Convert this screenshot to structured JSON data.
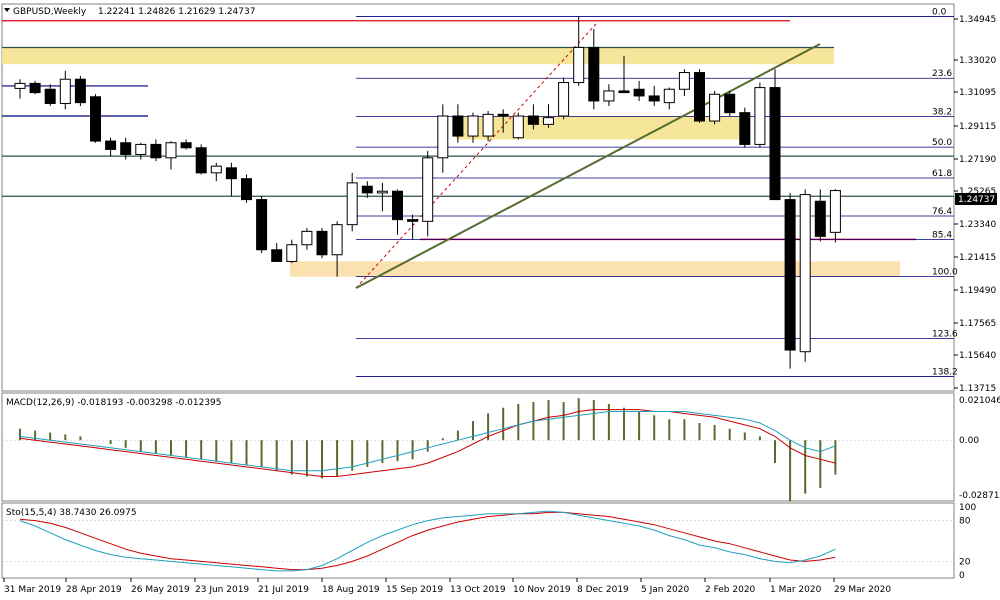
{
  "header": {
    "symbol": "GBPUSD,Weekly",
    "ohlc": "1.22241 1.24826 1.21629 1.24737"
  },
  "price_axis": {
    "ticks": [
      "1.34945",
      "1.33020",
      "1.31095",
      "1.29115",
      "1.27190",
      "1.25265",
      "1.23340",
      "1.21415",
      "1.19490",
      "1.17565",
      "1.15640",
      "1.13715"
    ],
    "current": "1.24737"
  },
  "date_axis": {
    "labels": [
      "31 Mar 2019",
      "28 Apr 2019",
      "26 May 2019",
      "23 Jun 2019",
      "21 Jul 2019",
      "18 Aug 2019",
      "15 Sep 2019",
      "13 Oct 2019",
      "10 Nov 2019",
      "8 Dec 2019",
      "5 Jan 2020",
      "2 Feb 2020",
      "1 Mar 2020",
      "29 Mar 2020"
    ]
  },
  "fibonacci": {
    "levels": [
      {
        "label": "0.0",
        "price": 1.3515
      },
      {
        "label": "23.6",
        "price": 1.3146
      },
      {
        "label": "38.2",
        "price": 1.2918
      },
      {
        "label": "50.0",
        "price": 1.2734
      },
      {
        "label": "61.8",
        "price": 1.2549
      },
      {
        "label": "76.4",
        "price": 1.2322
      },
      {
        "label": "85.4",
        "price": 1.2182
      },
      {
        "label": "100.0",
        "price": 1.1959
      },
      {
        "label": "123.6",
        "price": 1.159
      },
      {
        "label": "138.2",
        "price": 1.1362
      }
    ]
  },
  "macd": {
    "label": "MACD(12,26,9) -0.018193 -0.003298 -0.012395",
    "ticks": [
      "0.021046",
      "0.00",
      "-0.02871"
    ]
  },
  "stochastic": {
    "label": "Sto(15,5,4) 38.7430 26.0975",
    "ticks": [
      "100",
      "80",
      "20",
      "0"
    ]
  },
  "colors": {
    "bull": "#ffffff",
    "bear": "#000000",
    "fib": "#000080",
    "trend": "#556b2f",
    "red": "#e0001a",
    "zone": "#f5e69a",
    "zone2": "#fbe0b0",
    "hline": "#2f4f4f",
    "macd_hist": "#556b2f",
    "macd_signal": "#cc0000",
    "macd_line": "#20a0c0",
    "sto_main": "#20a0c0",
    "sto_signal": "#cc0000"
  },
  "chart_data": {
    "type": "candlestick",
    "symbol": "GBPUSD",
    "timeframe": "Weekly",
    "ylim": [
      1.1275,
      1.359
    ],
    "candles": [
      {
        "o": 1.3085,
        "h": 1.314,
        "l": 1.3025,
        "c": 1.3115
      },
      {
        "o": 1.3115,
        "h": 1.313,
        "l": 1.305,
        "c": 1.306
      },
      {
        "o": 1.308,
        "h": 1.311,
        "l": 1.298,
        "c": 1.2995
      },
      {
        "o": 1.2995,
        "h": 1.319,
        "l": 1.296,
        "c": 1.314
      },
      {
        "o": 1.314,
        "h": 1.316,
        "l": 1.298,
        "c": 1.3
      },
      {
        "o": 1.3035,
        "h": 1.305,
        "l": 1.276,
        "c": 1.277
      },
      {
        "o": 1.277,
        "h": 1.279,
        "l": 1.268,
        "c": 1.272
      },
      {
        "o": 1.276,
        "h": 1.279,
        "l": 1.266,
        "c": 1.269
      },
      {
        "o": 1.269,
        "h": 1.276,
        "l": 1.266,
        "c": 1.275
      },
      {
        "o": 1.275,
        "h": 1.278,
        "l": 1.265,
        "c": 1.267
      },
      {
        "o": 1.267,
        "h": 1.277,
        "l": 1.26,
        "c": 1.276
      },
      {
        "o": 1.276,
        "h": 1.278,
        "l": 1.272,
        "c": 1.273
      },
      {
        "o": 1.273,
        "h": 1.275,
        "l": 1.257,
        "c": 1.258
      },
      {
        "o": 1.258,
        "h": 1.264,
        "l": 1.253,
        "c": 1.262
      },
      {
        "o": 1.261,
        "h": 1.264,
        "l": 1.244,
        "c": 1.2545
      },
      {
        "o": 1.2545,
        "h": 1.257,
        "l": 1.24,
        "c": 1.242
      },
      {
        "o": 1.242,
        "h": 1.244,
        "l": 1.21,
        "c": 1.212
      },
      {
        "o": 1.212,
        "h": 1.216,
        "l": 1.205,
        "c": 1.205
      },
      {
        "o": 1.205,
        "h": 1.218,
        "l": 1.204,
        "c": 1.215
      },
      {
        "o": 1.215,
        "h": 1.225,
        "l": 1.212,
        "c": 1.223
      },
      {
        "o": 1.223,
        "h": 1.225,
        "l": 1.207,
        "c": 1.209
      },
      {
        "o": 1.209,
        "h": 1.229,
        "l": 1.1959,
        "c": 1.227
      },
      {
        "o": 1.227,
        "h": 1.258,
        "l": 1.223,
        "c": 1.252
      },
      {
        "o": 1.25,
        "h": 1.253,
        "l": 1.243,
        "c": 1.246
      },
      {
        "o": 1.246,
        "h": 1.252,
        "l": 1.235,
        "c": 1.247
      },
      {
        "o": 1.247,
        "h": 1.248,
        "l": 1.221,
        "c": 1.23
      },
      {
        "o": 1.23,
        "h": 1.233,
        "l": 1.218,
        "c": 1.229
      },
      {
        "o": 1.229,
        "h": 1.271,
        "l": 1.22,
        "c": 1.267
      },
      {
        "o": 1.267,
        "h": 1.299,
        "l": 1.258,
        "c": 1.292
      },
      {
        "o": 1.292,
        "h": 1.299,
        "l": 1.276,
        "c": 1.28
      },
      {
        "o": 1.28,
        "h": 1.294,
        "l": 1.276,
        "c": 1.292
      },
      {
        "o": 1.28,
        "h": 1.295,
        "l": 1.277,
        "c": 1.293
      },
      {
        "o": 1.293,
        "h": 1.296,
        "l": 1.282,
        "c": 1.292
      },
      {
        "o": 1.279,
        "h": 1.294,
        "l": 1.278,
        "c": 1.292
      },
      {
        "o": 1.292,
        "h": 1.299,
        "l": 1.284,
        "c": 1.287
      },
      {
        "o": 1.287,
        "h": 1.299,
        "l": 1.285,
        "c": 1.291
      },
      {
        "o": 1.292,
        "h": 1.315,
        "l": 1.29,
        "c": 1.312
      },
      {
        "o": 1.312,
        "h": 1.3515,
        "l": 1.31,
        "c": 1.333
      },
      {
        "o": 1.333,
        "h": 1.344,
        "l": 1.296,
        "c": 1.301
      },
      {
        "o": 1.301,
        "h": 1.311,
        "l": 1.298,
        "c": 1.307
      },
      {
        "o": 1.307,
        "h": 1.328,
        "l": 1.306,
        "c": 1.306
      },
      {
        "o": 1.308,
        "h": 1.313,
        "l": 1.301,
        "c": 1.304
      },
      {
        "o": 1.304,
        "h": 1.31,
        "l": 1.298,
        "c": 1.301
      },
      {
        "o": 1.3,
        "h": 1.309,
        "l": 1.296,
        "c": 1.308
      },
      {
        "o": 1.308,
        "h": 1.32,
        "l": 1.304,
        "c": 1.318
      },
      {
        "o": 1.318,
        "h": 1.32,
        "l": 1.288,
        "c": 1.289
      },
      {
        "o": 1.289,
        "h": 1.307,
        "l": 1.287,
        "c": 1.305
      },
      {
        "o": 1.305,
        "h": 1.307,
        "l": 1.292,
        "c": 1.294
      },
      {
        "o": 1.294,
        "h": 1.297,
        "l": 1.273,
        "c": 1.275
      },
      {
        "o": 1.275,
        "h": 1.312,
        "l": 1.273,
        "c": 1.309
      },
      {
        "o": 1.309,
        "h": 1.32,
        "l": 1.284,
        "c": 1.242
      },
      {
        "o": 1.242,
        "h": 1.246,
        "l": 1.1409,
        "c": 1.152
      },
      {
        "o": 1.151,
        "h": 1.248,
        "l": 1.145,
        "c": 1.245
      },
      {
        "o": 1.241,
        "h": 1.248,
        "l": 1.217,
        "c": 1.22
      },
      {
        "o": 1.2224,
        "h": 1.2483,
        "l": 1.2163,
        "c": 1.2474
      }
    ],
    "zones": [
      {
        "from": 1.323,
        "to": 1.333,
        "label": ""
      },
      {
        "from": 1.278,
        "to": 1.292,
        "label": ""
      },
      {
        "from": 1.1959,
        "to": 1.205,
        "label": ""
      }
    ],
    "horizontal_lines": [
      1.349,
      1.333,
      1.31,
      1.292,
      1.268,
      1.244,
      1.2182
    ],
    "macd": {
      "hist": [
        0.006,
        0.005,
        0.004,
        0.003,
        0.002,
        0.0,
        -0.002,
        -0.004,
        -0.006,
        -0.007,
        -0.008,
        -0.009,
        -0.01,
        -0.011,
        -0.012,
        -0.013,
        -0.014,
        -0.016,
        -0.018,
        -0.019,
        -0.02,
        -0.019,
        -0.016,
        -0.014,
        -0.012,
        -0.011,
        -0.01,
        -0.006,
        0.001,
        0.005,
        0.01,
        0.014,
        0.017,
        0.019,
        0.02,
        0.021,
        0.02,
        0.022,
        0.021,
        0.019,
        0.017,
        0.015,
        0.013,
        0.011,
        0.011,
        0.009,
        0.008,
        0.006,
        0.004,
        0.002,
        -0.012,
        -0.032,
        -0.028,
        -0.025,
        -0.018
      ],
      "signal": [
        0.001,
        0.0,
        -0.001,
        -0.002,
        -0.003,
        -0.004,
        -0.005,
        -0.006,
        -0.007,
        -0.008,
        -0.009,
        -0.01,
        -0.011,
        -0.012,
        -0.013,
        -0.014,
        -0.015,
        -0.016,
        -0.017,
        -0.018,
        -0.019,
        -0.019,
        -0.018,
        -0.017,
        -0.016,
        -0.015,
        -0.014,
        -0.012,
        -0.009,
        -0.006,
        -0.002,
        0.002,
        0.005,
        0.008,
        0.01,
        0.012,
        0.013,
        0.015,
        0.016,
        0.016,
        0.016,
        0.016,
        0.015,
        0.015,
        0.014,
        0.013,
        0.012,
        0.01,
        0.008,
        0.006,
        0.002,
        -0.004,
        -0.008,
        -0.01,
        -0.012
      ],
      "line": [
        0.002,
        0.001,
        0.0,
        -0.001,
        -0.002,
        -0.003,
        -0.004,
        -0.005,
        -0.006,
        -0.007,
        -0.008,
        -0.009,
        -0.01,
        -0.011,
        -0.012,
        -0.013,
        -0.014,
        -0.015,
        -0.016,
        -0.016,
        -0.016,
        -0.015,
        -0.014,
        -0.012,
        -0.01,
        -0.008,
        -0.006,
        -0.004,
        -0.002,
        0.0,
        0.002,
        0.004,
        0.006,
        0.008,
        0.01,
        0.011,
        0.012,
        0.013,
        0.014,
        0.015,
        0.015,
        0.015,
        0.015,
        0.015,
        0.015,
        0.014,
        0.013,
        0.012,
        0.011,
        0.009,
        0.005,
        0.0,
        -0.004,
        -0.006,
        -0.003
      ]
    },
    "stochastic": {
      "main": [
        80,
        72,
        62,
        52,
        44,
        36,
        30,
        26,
        24,
        22,
        20,
        18,
        16,
        14,
        12,
        10,
        8,
        6,
        6,
        8,
        14,
        24,
        36,
        48,
        58,
        66,
        74,
        80,
        84,
        86,
        88,
        90,
        90,
        90,
        92,
        94,
        92,
        88,
        84,
        80,
        76,
        72,
        66,
        58,
        52,
        44,
        40,
        34,
        30,
        24,
        20,
        18,
        22,
        28,
        38
      ],
      "signal": [
        82,
        80,
        76,
        70,
        62,
        54,
        46,
        38,
        32,
        28,
        24,
        22,
        20,
        18,
        16,
        14,
        12,
        10,
        8,
        8,
        10,
        14,
        20,
        28,
        38,
        48,
        58,
        66,
        72,
        78,
        82,
        86,
        88,
        90,
        90,
        92,
        92,
        90,
        88,
        86,
        82,
        78,
        74,
        68,
        62,
        56,
        50,
        46,
        40,
        34,
        28,
        22,
        20,
        22,
        26
      ]
    }
  }
}
